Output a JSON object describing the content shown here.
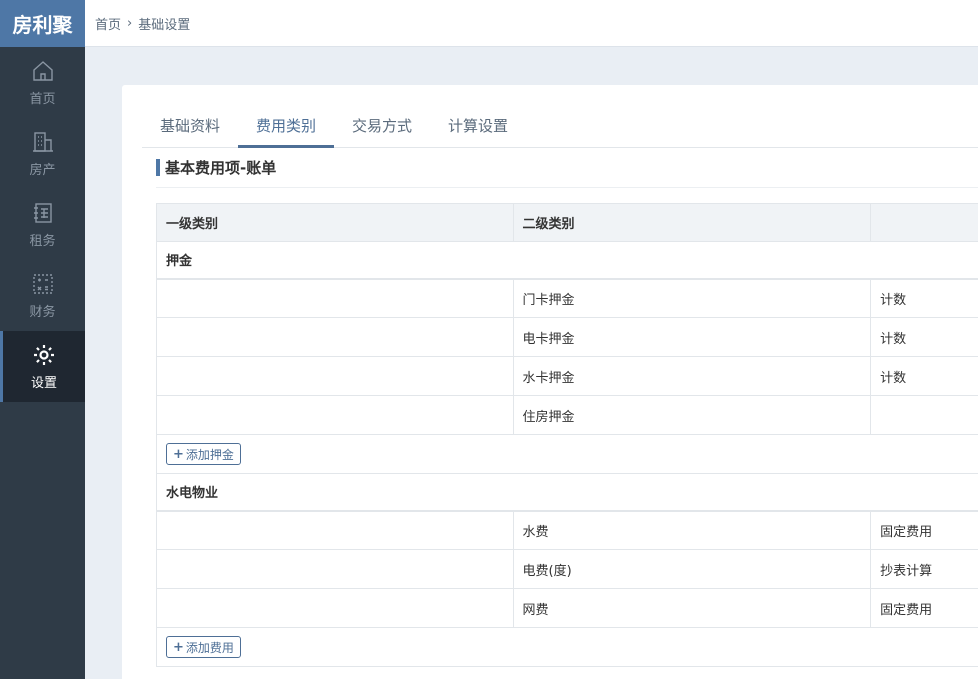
{
  "logo": "房利聚",
  "sidebar": {
    "items": [
      {
        "label": "首页",
        "icon": "home-icon"
      },
      {
        "label": "房产",
        "icon": "building-icon"
      },
      {
        "label": "租务",
        "icon": "rent-icon"
      },
      {
        "label": "财务",
        "icon": "finance-icon"
      },
      {
        "label": "设置",
        "icon": "gear-icon"
      }
    ]
  },
  "breadcrumb": {
    "home": "首页",
    "current": "基础设置"
  },
  "tabs": [
    "基础资料",
    "费用类别",
    "交易方式",
    "计算设置"
  ],
  "section_title": "基本费用项-账单",
  "table": {
    "headers": [
      "一级类别",
      "二级类别",
      ""
    ],
    "groups": [
      {
        "name": "押金",
        "rows": [
          {
            "sub": "门卡押金",
            "mode": "计数"
          },
          {
            "sub": "电卡押金",
            "mode": "计数"
          },
          {
            "sub": "水卡押金",
            "mode": "计数"
          },
          {
            "sub": "住房押金",
            "mode": ""
          }
        ],
        "add_label": "添加押金"
      },
      {
        "name": "水电物业",
        "rows": [
          {
            "sub": "水费",
            "mode": "固定费用"
          },
          {
            "sub": "电费(度)",
            "mode": "抄表计算"
          },
          {
            "sub": "网费",
            "mode": "固定费用"
          }
        ],
        "add_label": "添加费用"
      }
    ]
  },
  "colors": {
    "accent": "#4e77a6",
    "sidebar_bg": "#2f3b47",
    "active_bg": "#1f2731"
  }
}
